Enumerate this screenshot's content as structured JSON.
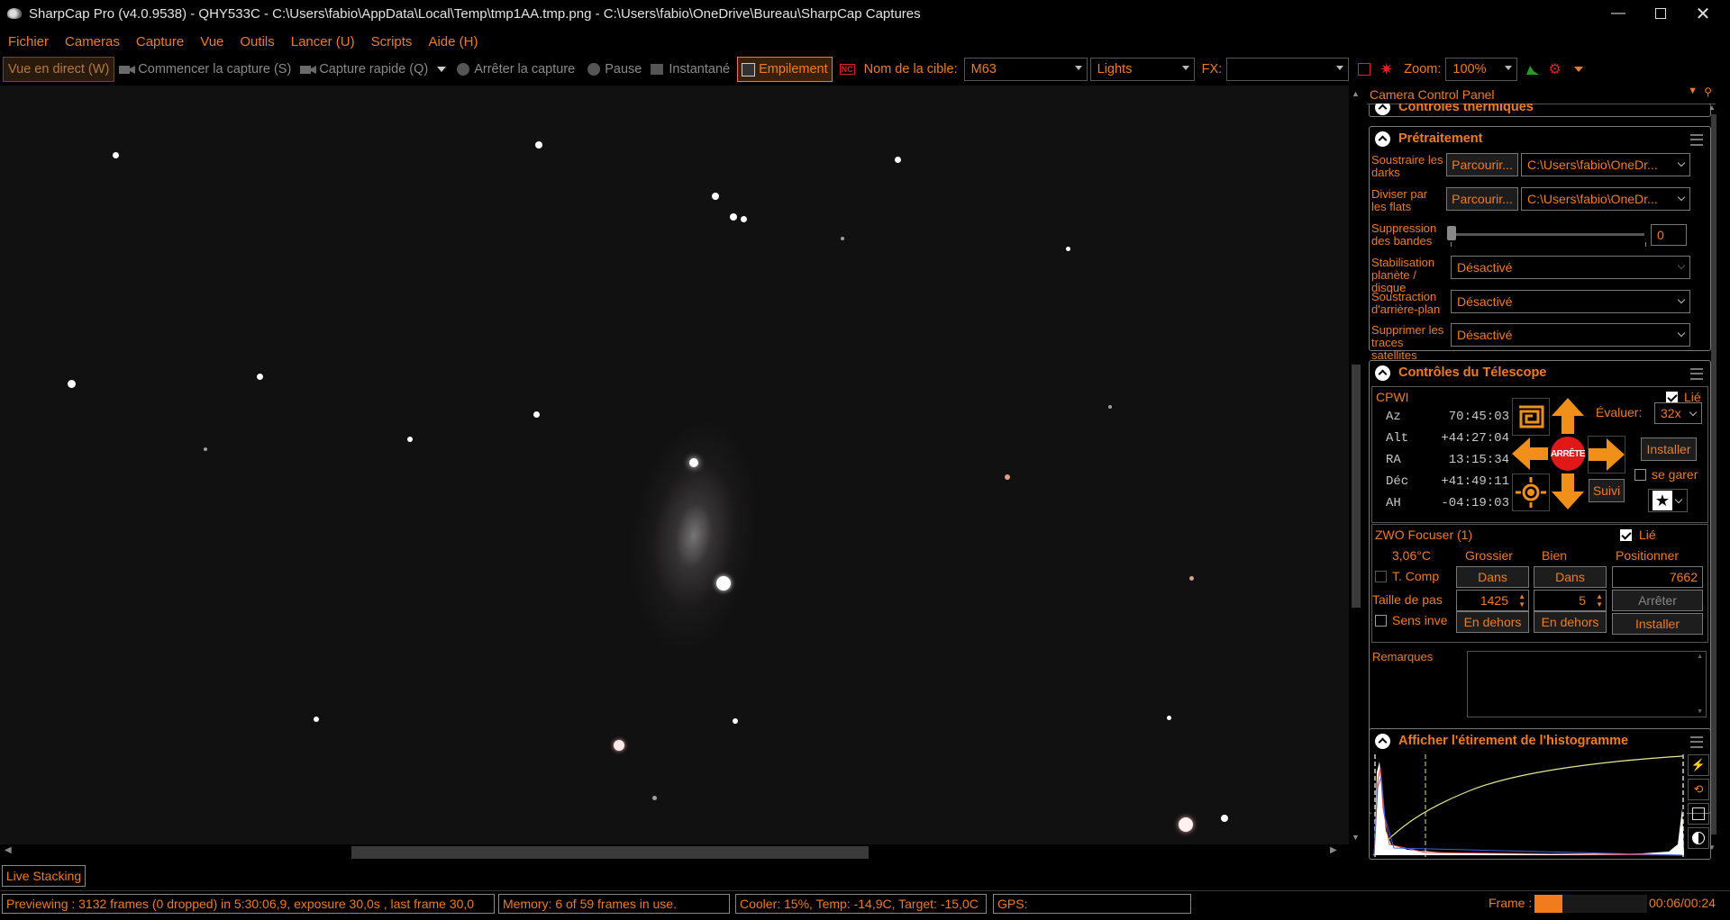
{
  "window": {
    "title": "SharpCap Pro (v4.0.9538) - QHY533C - C:\\Users\\fabio\\AppData\\Local\\Temp\\tmp1AA.tmp.png - C:\\Users\\fabio\\OneDrive\\Bureau\\SharpCap Captures"
  },
  "menu": [
    "Fichier",
    "Cameras",
    "Capture",
    "Vue",
    "Outils",
    "Lancer (U)",
    "Scripts",
    "Aide (H)"
  ],
  "toolbar": {
    "live_view": "Vue en direct (W)",
    "start_capture": "Commencer la capture (S)",
    "quick_capture": "Capture rapide (Q)",
    "stop_capture": "Arrêter la capture",
    "pause": "Pause",
    "snapshot": "Instantané",
    "stacking": "Empilement",
    "target_label": "Nom de la cible:",
    "target_value": "M63",
    "frame_type": "Lights",
    "fx_label": "FX:",
    "fx_value": "",
    "zoom_label": "Zoom:",
    "zoom_value": "100%"
  },
  "panel": {
    "title": "Camera Control Panel",
    "thermal_title": "Contrôles thermiques",
    "preprocess": {
      "title": "Prétraitement",
      "darks_label": "Soustraire les darks",
      "flats_label": "Diviser par les flats",
      "browse": "Parcourir...",
      "darks_path": "C:\\Users\\fabio\\OneDr...",
      "flats_path": "C:\\Users\\fabio\\OneDr...",
      "banding_label": "Suppression des bandes",
      "banding_value": "0",
      "banding_level": 0,
      "stabilize_label": "Stabilisation planète / disque",
      "stabilize_value": "Désactivé",
      "background_label": "Soustraction d'arrière-plan",
      "background_value": "Désactivé",
      "satellite_label": "Supprimer les traces satellites",
      "satellite_value": "Désactivé"
    },
    "telescope": {
      "title": "Contrôles du Télescope",
      "mount": "CPWI",
      "linked": "Lié",
      "az_label": "Az",
      "az": "70:45:03",
      "alt_label": "Alt",
      "alt": "+44:27:04",
      "ra_label": "RA",
      "ra": "13:15:34",
      "dec_label": "Déc",
      "dec": "+41:49:11",
      "ah_label": "AH",
      "ah": "-04:19:03",
      "stop": "ARRÊTE",
      "track": "Suivi",
      "rate_label": "Évaluer:",
      "rate_value": "32x",
      "setup": "Installer",
      "park": "se garer"
    },
    "focuser": {
      "name": "ZWO Focuser (1)",
      "linked": "Lié",
      "temp": "3,06°C",
      "coarse": "Grossier",
      "fine": "Bien",
      "position_label": "Positionner",
      "tcomp": "T. Comp",
      "in": "Dans",
      "position": "7662",
      "step_label": "Taille de pas",
      "coarse_step": "1425",
      "fine_step": "5",
      "stop": "Arrêter",
      "reverse": "Sens inve",
      "out": "En dehors",
      "setup": "Installer"
    },
    "notes_label": "Remarques",
    "histogram_title": "Afficher l'étirement de l'histogramme"
  },
  "bottom": {
    "live_stacking": "Live Stacking",
    "status": "Previewing : 3132 frames (0 dropped) in 5:30:06,9, exposure 30,0s , last frame 30,0",
    "memory": "Memory: 6 of 59 frames in use.",
    "cooler": "Cooler: 15%, Temp: -14,9C, Target: -15,0C",
    "gps": "GPS:",
    "frame_label": "Frame :",
    "frame_time": "00:06/00:24",
    "frame_progress": 0.25
  },
  "colors": {
    "accent": "#f07c1e",
    "background": "#000000",
    "sky": "#121112"
  },
  "icons": {
    "app": "telescope-icon",
    "goto": "spiral-icon",
    "center": "sun-icon",
    "star": "star-icon"
  }
}
